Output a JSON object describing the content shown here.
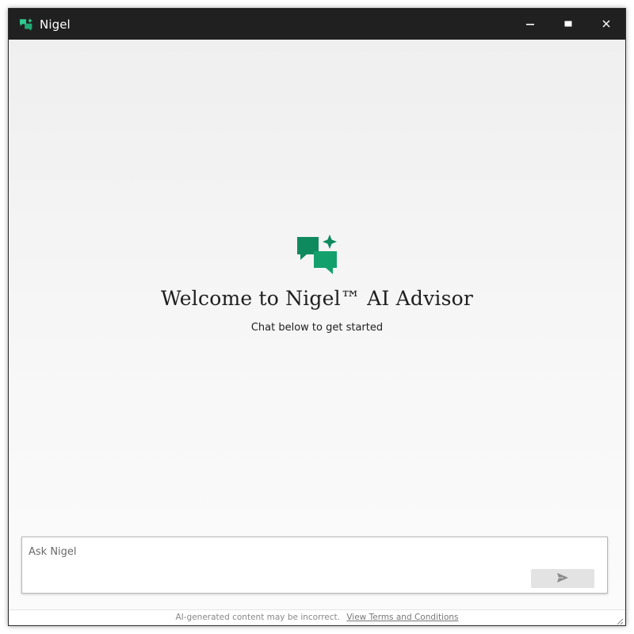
{
  "window": {
    "title": "Nigel",
    "app_icon": "chat-sparkle-icon",
    "controls": {
      "minimize_icon": "minimize-icon",
      "maximize_icon": "maximize-icon",
      "close_icon": "close-icon"
    }
  },
  "welcome": {
    "icon": "chat-sparkle-icon",
    "title": "Welcome to Nigel™ AI Advisor",
    "subtitle": "Chat below to get started"
  },
  "chat": {
    "placeholder": "Ask Nigel",
    "value": "",
    "send_icon": "send-icon"
  },
  "footer": {
    "disclaimer": "AI-generated content may be incorrect.",
    "terms_link": "View Terms and Conditions"
  },
  "colors": {
    "brand_green": "#0f8a5f",
    "titlebar": "#202020",
    "background": "#f6f6f6",
    "send_button": "#e3e3e3"
  }
}
